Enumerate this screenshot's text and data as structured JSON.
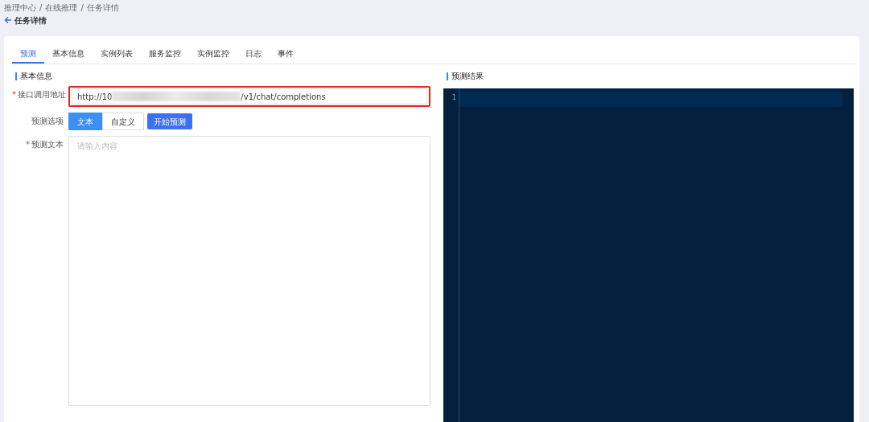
{
  "breadcrumb": [
    {
      "label": "推理中心"
    },
    {
      "label": "在线推理"
    },
    {
      "label": "任务详情"
    }
  ],
  "breadcrumb_separator": "/",
  "page_title": "任务详情",
  "tabs": [
    {
      "label": "预测",
      "selected": true
    },
    {
      "label": "基本信息",
      "selected": false
    },
    {
      "label": "实例列表",
      "selected": false
    },
    {
      "label": "服务监控",
      "selected": false
    },
    {
      "label": "实例监控",
      "selected": false
    },
    {
      "label": "日志",
      "selected": false
    },
    {
      "label": "事件",
      "selected": false
    }
  ],
  "form": {
    "section_title": "基本信息",
    "required_mark": "*",
    "endpoint": {
      "label": "接口调用地址",
      "required": true,
      "value_start": "http://10",
      "value_end": "/v1/chat/completions",
      "highlighted": true
    },
    "options": {
      "label": "预测选项",
      "choices": [
        {
          "label": "文本",
          "selected": true
        },
        {
          "label": "自定义",
          "selected": false
        }
      ],
      "button": "开始预测"
    },
    "text": {
      "label": "预测文本",
      "required": true,
      "placeholder": "请输入内容"
    }
  },
  "result": {
    "section_title": "预测结果",
    "line_numbers": [
      "1"
    ]
  }
}
